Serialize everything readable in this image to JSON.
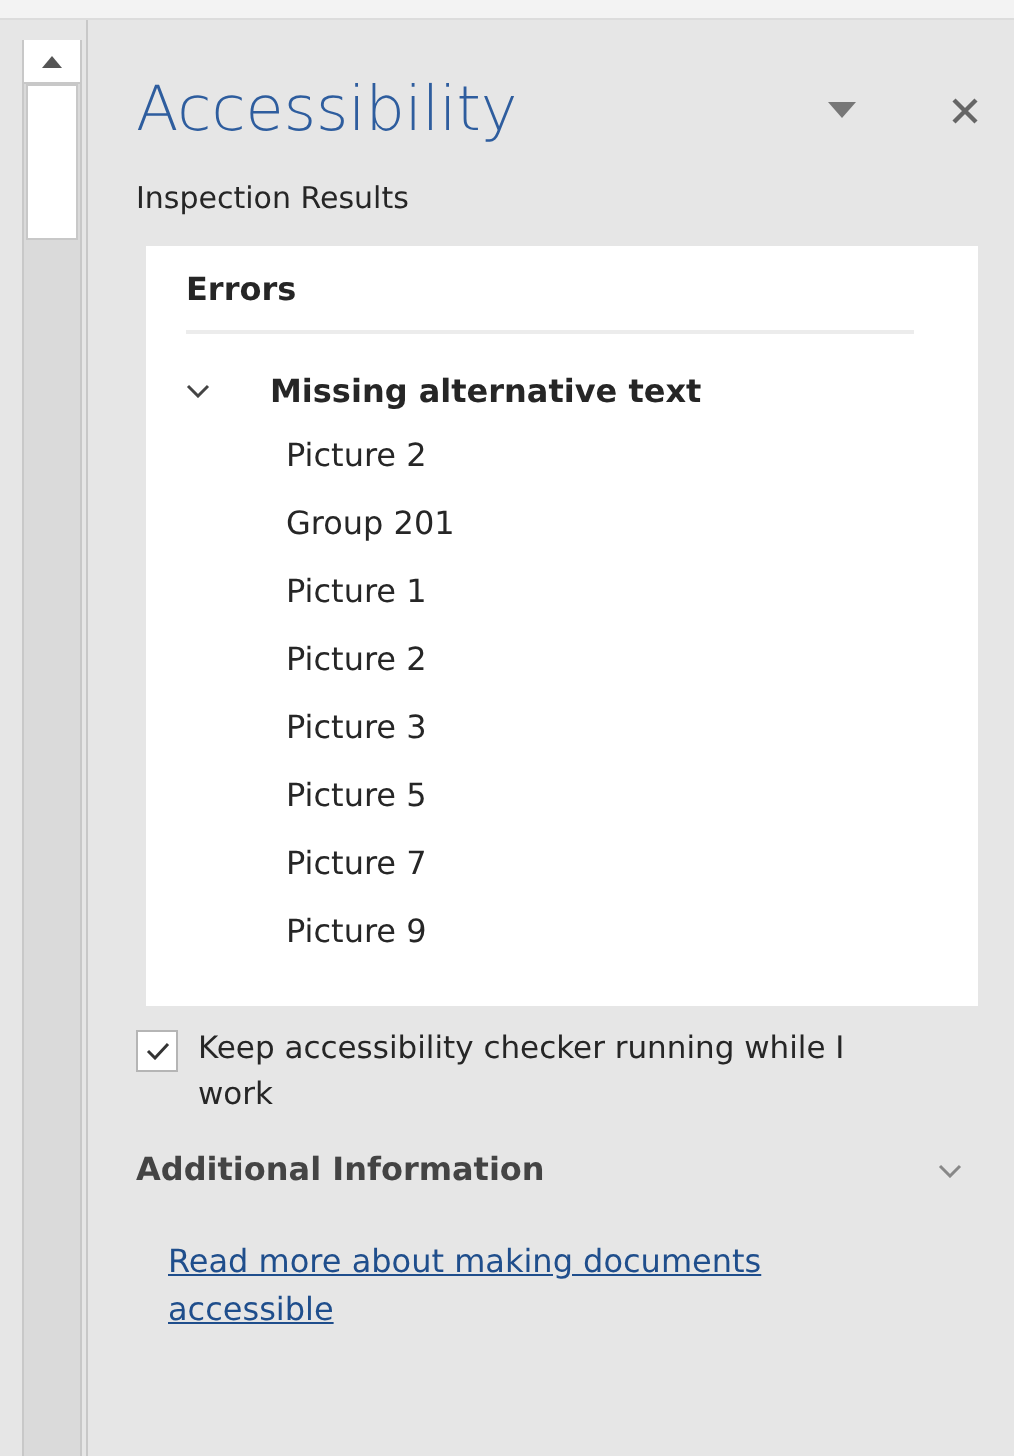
{
  "title": "Accessibility",
  "subtitle": "Inspection Results",
  "results": {
    "heading": "Errors",
    "groups": [
      {
        "label": "Missing alternative text",
        "expanded": true,
        "children": [
          {
            "label": "Picture 2"
          },
          {
            "label": "Group 201"
          },
          {
            "label": "Picture 1"
          },
          {
            "label": "Picture 2"
          },
          {
            "label": "Picture 3"
          },
          {
            "label": "Picture 5"
          },
          {
            "label": "Picture 7"
          },
          {
            "label": "Picture 9"
          }
        ]
      }
    ]
  },
  "keep_running": {
    "label": "Keep accessibility checker running while I work",
    "checked": true
  },
  "additional_info": {
    "label": "Additional Information",
    "expanded": false
  },
  "link": "Read more about making documents accessible"
}
